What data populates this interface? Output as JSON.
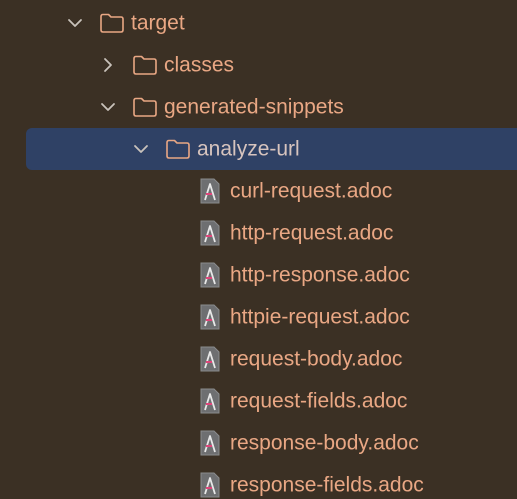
{
  "tree": {
    "target": {
      "label": "target",
      "expanded": true,
      "icon": "folder-icon"
    },
    "classes": {
      "label": "classes",
      "expanded": false,
      "icon": "folder-icon"
    },
    "generated_snippets": {
      "label": "generated-snippets",
      "expanded": true,
      "icon": "folder-icon"
    },
    "analyze_url": {
      "label": "analyze-url",
      "expanded": true,
      "icon": "folder-icon",
      "selected": true
    },
    "files": [
      {
        "label": "curl-request.adoc",
        "icon": "asciidoc-file-icon"
      },
      {
        "label": "http-request.adoc",
        "icon": "asciidoc-file-icon"
      },
      {
        "label": "http-response.adoc",
        "icon": "asciidoc-file-icon"
      },
      {
        "label": "httpie-request.adoc",
        "icon": "asciidoc-file-icon"
      },
      {
        "label": "request-body.adoc",
        "icon": "asciidoc-file-icon"
      },
      {
        "label": "request-fields.adoc",
        "icon": "asciidoc-file-icon"
      },
      {
        "label": "response-body.adoc",
        "icon": "asciidoc-file-icon"
      },
      {
        "label": "response-fields.adoc",
        "icon": "asciidoc-file-icon"
      }
    ]
  },
  "colors": {
    "background": "#3b3024",
    "selection": "#2f4165",
    "text": "#e9a784",
    "selected_text": "#d7c4be",
    "folder_outline": "#e9a784"
  }
}
